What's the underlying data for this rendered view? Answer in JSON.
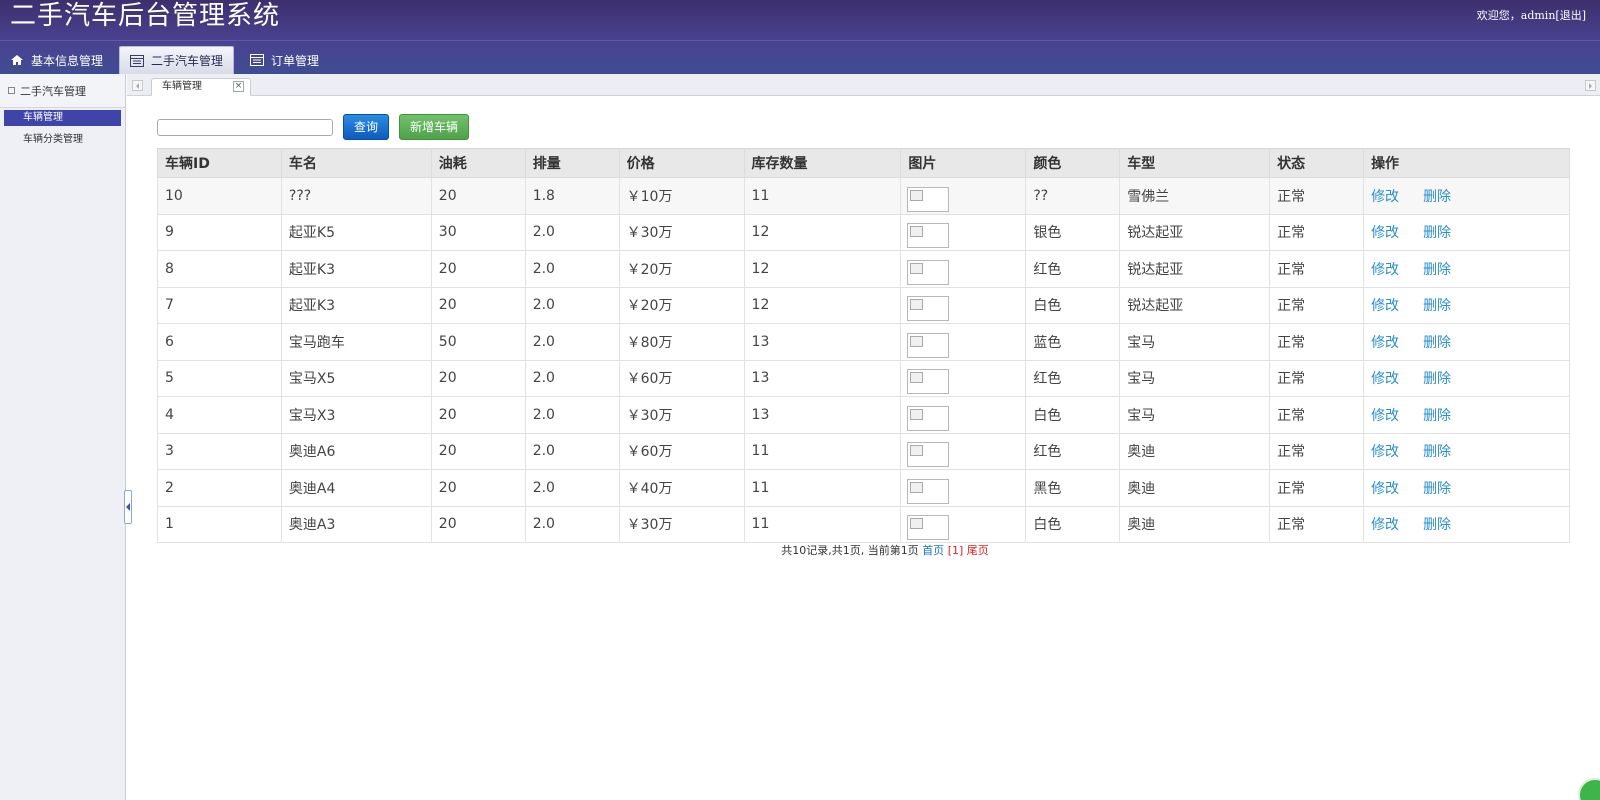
{
  "header": {
    "title": "二手汽车后台管理系统",
    "welcome": "欢迎您，admin",
    "logout": "[退出]"
  },
  "top_tabs": [
    {
      "label": "基本信息管理",
      "icon": "home-icon"
    },
    {
      "label": "二手汽车管理",
      "icon": "table-icon"
    },
    {
      "label": "订单管理",
      "icon": "table-icon"
    }
  ],
  "sidebar": {
    "heading": "二手汽车管理",
    "items": [
      {
        "label": "车辆管理"
      },
      {
        "label": "车辆分类管理"
      }
    ]
  },
  "content_tab": {
    "label": "车辆管理",
    "close": "×"
  },
  "toolbar": {
    "search_value": "",
    "query_label": "查询",
    "add_label": "新增车辆"
  },
  "table": {
    "columns": [
      "车辆ID",
      "车名",
      "油耗",
      "排量",
      "价格",
      "库存数量",
      "图片",
      "颜色",
      "车型",
      "状态",
      "操作"
    ],
    "rows": [
      {
        "id": "10",
        "name": "???",
        "fuel": "20",
        "displacement": "1.8",
        "price": "￥10万",
        "stock": "11",
        "color": "??",
        "model": "雪佛兰",
        "status": "正常"
      },
      {
        "id": "9",
        "name": "起亚K5",
        "fuel": "30",
        "displacement": "2.0",
        "price": "￥30万",
        "stock": "12",
        "color": "银色",
        "model": "锐达起亚",
        "status": "正常"
      },
      {
        "id": "8",
        "name": "起亚K3",
        "fuel": "20",
        "displacement": "2.0",
        "price": "￥20万",
        "stock": "12",
        "color": "红色",
        "model": "锐达起亚",
        "status": "正常"
      },
      {
        "id": "7",
        "name": "起亚K3",
        "fuel": "20",
        "displacement": "2.0",
        "price": "￥20万",
        "stock": "12",
        "color": "白色",
        "model": "锐达起亚",
        "status": "正常"
      },
      {
        "id": "6",
        "name": "宝马跑车",
        "fuel": "50",
        "displacement": "2.0",
        "price": "￥80万",
        "stock": "13",
        "color": "蓝色",
        "model": "宝马",
        "status": "正常"
      },
      {
        "id": "5",
        "name": "宝马X5",
        "fuel": "20",
        "displacement": "2.0",
        "price": "￥60万",
        "stock": "13",
        "color": "红色",
        "model": "宝马",
        "status": "正常"
      },
      {
        "id": "4",
        "name": "宝马X3",
        "fuel": "20",
        "displacement": "2.0",
        "price": "￥30万",
        "stock": "13",
        "color": "白色",
        "model": "宝马",
        "status": "正常"
      },
      {
        "id": "3",
        "name": "奥迪A6",
        "fuel": "20",
        "displacement": "2.0",
        "price": "￥60万",
        "stock": "11",
        "color": "红色",
        "model": "奥迪",
        "status": "正常"
      },
      {
        "id": "2",
        "name": "奥迪A4",
        "fuel": "20",
        "displacement": "2.0",
        "price": "￥40万",
        "stock": "11",
        "color": "黑色",
        "model": "奥迪",
        "status": "正常"
      },
      {
        "id": "1",
        "name": "奥迪A3",
        "fuel": "20",
        "displacement": "2.0",
        "price": "￥30万",
        "stock": "11",
        "color": "白色",
        "model": "奥迪",
        "status": "正常"
      }
    ],
    "edit_label": "修改",
    "delete_label": "删除"
  },
  "pager": {
    "summary": "共10记录,共1页, 当前第1页",
    "first": "首页",
    "current": "[1]",
    "last": "尾页"
  }
}
